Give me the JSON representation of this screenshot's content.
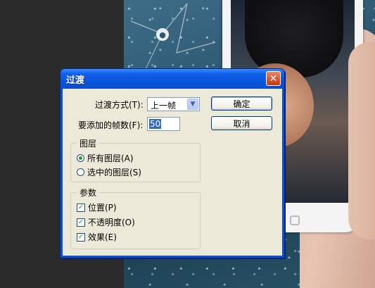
{
  "dialog": {
    "title": "过渡",
    "close_icon": "close-x-icon",
    "method_label": "过渡方式(T):",
    "method_value": "上一帧",
    "frames_label": "要添加的帧数(F):",
    "frames_value": "50",
    "ok_label": "确定",
    "cancel_label": "取消",
    "layers_group": {
      "title": "图层",
      "options": [
        "所有图层(A)",
        "选中的图层(S)"
      ],
      "selected": 0
    },
    "params_group": {
      "title": "参数",
      "options": [
        "位置(P)",
        "不透明度(O)",
        "效果(E)"
      ],
      "checked": [
        true,
        true,
        true
      ]
    }
  },
  "colors": {
    "title_bar": "#0a4fd6",
    "close_button": "#d8532f",
    "client_bg": "#ece9d8",
    "selection": "#316ac5",
    "check_mark": "#21a121"
  }
}
